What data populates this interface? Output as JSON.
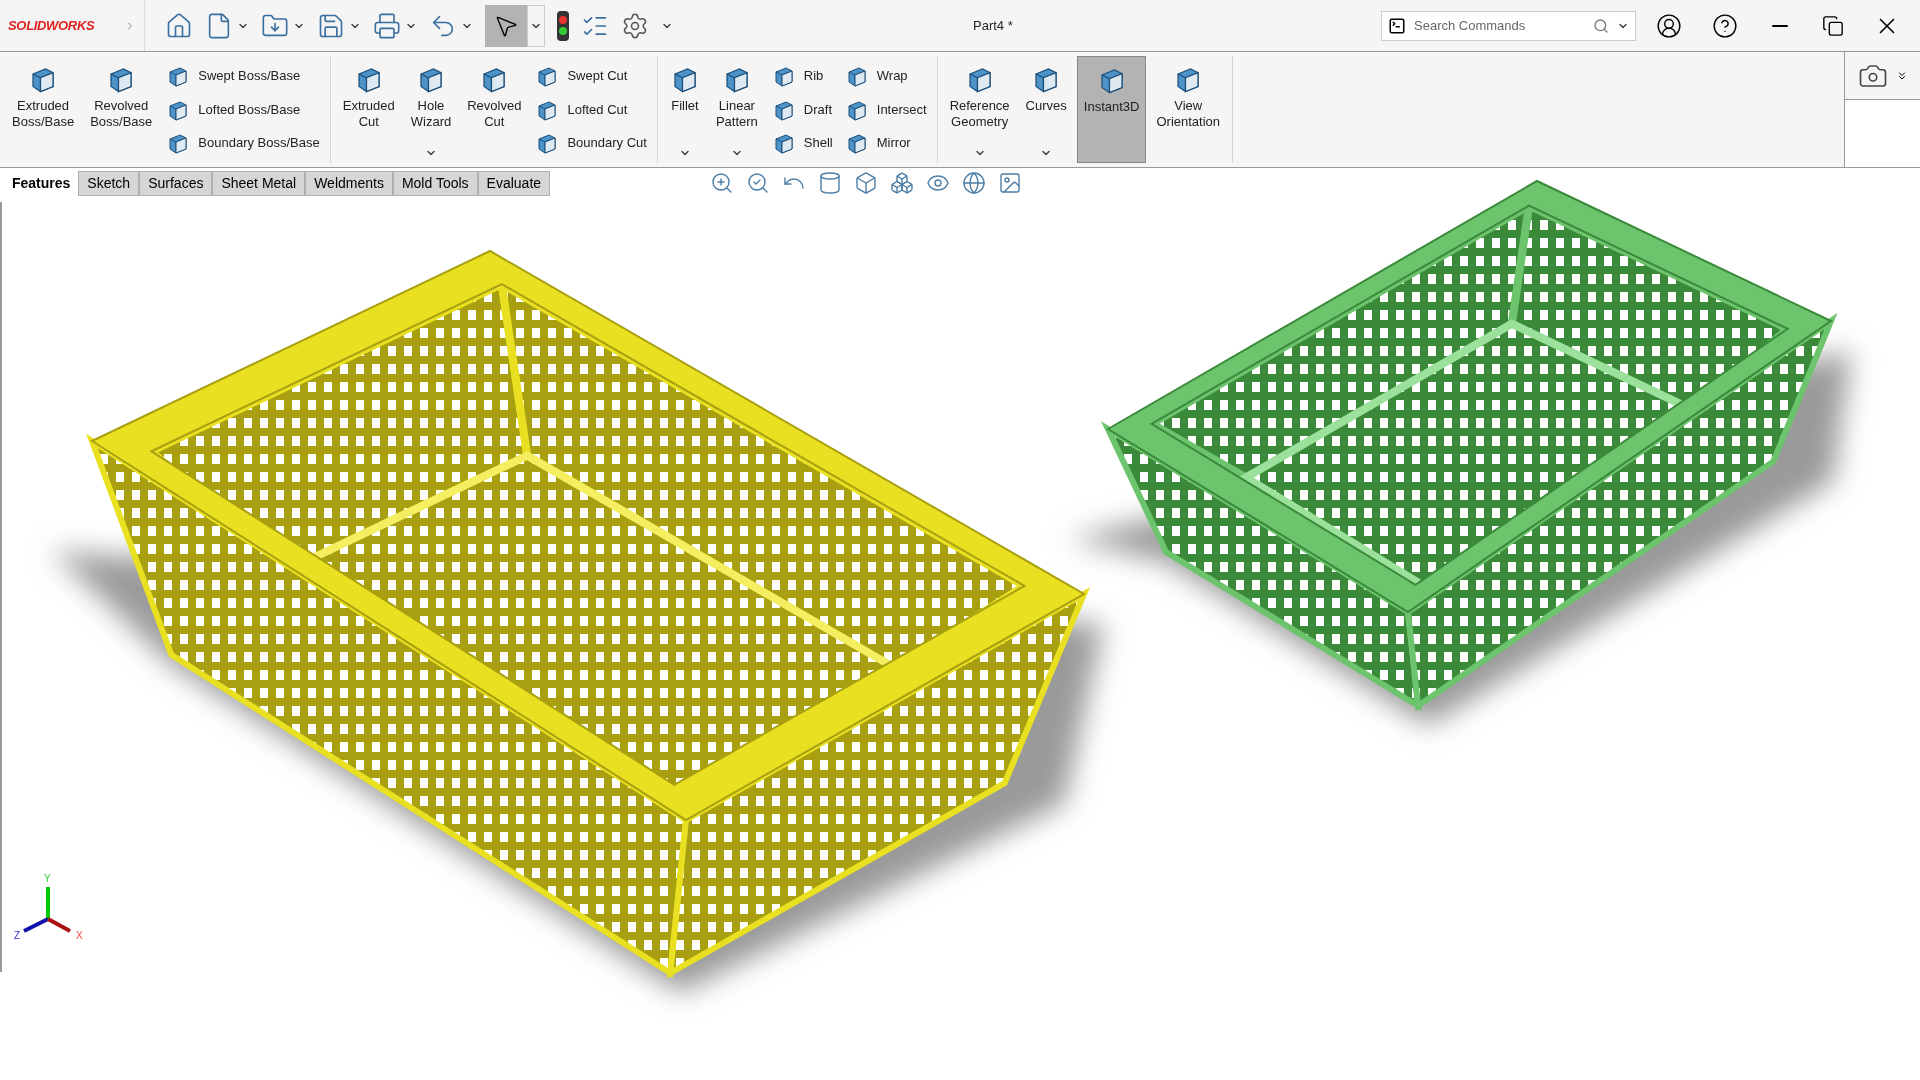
{
  "title_bar": {
    "logo": "SOLIDWORKS",
    "select_tool": {
      "selected": true
    },
    "document_title": "Part4 *",
    "search": {
      "placeholder": "Search Commands"
    }
  },
  "ribbon": {
    "groups": [
      {
        "columns": [
          {
            "kind": "large",
            "label": "Extruded\nBoss/Base",
            "dropdown": false,
            "selected": false
          },
          {
            "kind": "large",
            "label": "Revolved\nBoss/Base",
            "dropdown": false,
            "selected": false
          },
          {
            "kind": "stack",
            "labels": [
              "Swept Boss/Base",
              "Lofted Boss/Base",
              "Boundary Boss/Base"
            ]
          }
        ]
      },
      {
        "columns": [
          {
            "kind": "large",
            "label": "Extruded\nCut",
            "dropdown": false,
            "selected": false
          },
          {
            "kind": "large",
            "label": "Hole\nWizard",
            "dropdown": true,
            "selected": false
          },
          {
            "kind": "large",
            "label": "Revolved\nCut",
            "dropdown": false,
            "selected": false
          },
          {
            "kind": "stack",
            "labels": [
              "Swept Cut",
              "Lofted Cut",
              "Boundary Cut"
            ]
          }
        ]
      },
      {
        "columns": [
          {
            "kind": "large",
            "label": "Fillet",
            "dropdown": true,
            "selected": false
          },
          {
            "kind": "large",
            "label": "Linear\nPattern",
            "dropdown": true,
            "selected": false
          },
          {
            "kind": "stack",
            "labels": [
              "Rib",
              "Draft",
              "Shell"
            ]
          },
          {
            "kind": "stack",
            "labels": [
              "Wrap",
              "Intersect",
              "Mirror"
            ]
          }
        ]
      },
      {
        "columns": [
          {
            "kind": "large",
            "label": "Reference\nGeometry",
            "dropdown": true,
            "selected": false
          },
          {
            "kind": "large",
            "label": "Curves",
            "dropdown": true,
            "selected": false
          },
          {
            "kind": "large",
            "label": "Instant3D",
            "dropdown": false,
            "selected": true
          },
          {
            "kind": "large",
            "label": "View\nOrientation",
            "dropdown": false,
            "selected": false
          }
        ]
      }
    ]
  },
  "tabs": [
    {
      "label": "Features",
      "selected": true
    },
    {
      "label": "Sketch",
      "selected": false
    },
    {
      "label": "Surfaces",
      "selected": false
    },
    {
      "label": "Sheet Metal",
      "selected": false
    },
    {
      "label": "Weldments",
      "selected": false
    },
    {
      "label": "Mold Tools",
      "selected": false
    },
    {
      "label": "Evaluate",
      "selected": false
    }
  ],
  "triad": {
    "y": "Y",
    "z": "Z",
    "x": "X"
  }
}
